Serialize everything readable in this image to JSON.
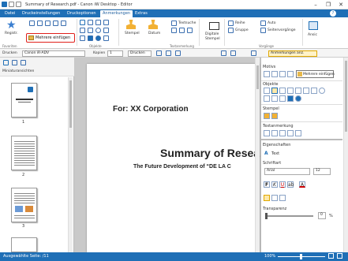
{
  "window": {
    "title": "Summary of Research.pdf - Canon iW Desktop - Editor",
    "controls": [
      "–",
      "❐",
      "✕"
    ]
  },
  "tabs": [
    {
      "label": "Datei",
      "active": false
    },
    {
      "label": "Druckeinstellungen",
      "active": false
    },
    {
      "label": "Druckoptionen",
      "active": false
    },
    {
      "label": "Anmerkungen",
      "active": true
    },
    {
      "label": "Extras",
      "active": false
    }
  ],
  "ribbon": {
    "groups": {
      "favoriten": "Favoriten",
      "objekte": "Objekte",
      "textanmerkung": "Textanmerkung",
      "vorgaenge": "Vorgänge"
    },
    "register": "Registr.",
    "mehrere": "Mehrere einfügen",
    "stempel": "Stempel",
    "datum": "Datum",
    "textsuche": "Textsuche",
    "digitale": "Digitale",
    "digitale2": "Stempel",
    "reihe": "Reihe",
    "gruppe": "Gruppe",
    "auto": "Auto",
    "seitenvorgaenge": "Seitenvorgänge",
    "ansic": "Ansic"
  },
  "toolbar": {
    "drucken_label": "Drucken",
    "printer": "Canon iR-ADV",
    "kopien_label": "Kopien",
    "kopien": "1",
    "drucken_btn": "Drucken",
    "anm_anz": "Anmerkungen anz."
  },
  "thumbnails": {
    "title": "Miniaturansichten",
    "pages": [
      "1",
      "2",
      "3"
    ]
  },
  "document": {
    "for_line": "For: XX Corporation",
    "title": "Summary of Resea",
    "subtitle": "The Future Development of “DE LA C"
  },
  "panel": {
    "motivs": "Motivs",
    "mehrere": "Mehrere einfügen",
    "objekte": "Objekte",
    "stempel": "Stempel",
    "textanmerkung": "Textanmerkung",
    "eigenschaften": "Eigenschaften",
    "text": "Text",
    "schriftart": "Schriftart",
    "font": "Arial",
    "size": "12",
    "transparenz": "Transparenz",
    "transparenz_val": "0",
    "pct": "%"
  },
  "status": {
    "left": "Ausgewählte Seite: /11",
    "zoom": "100%"
  },
  "colors": {
    "accent": "#1f6fb6",
    "highlight": "#e0201b"
  }
}
